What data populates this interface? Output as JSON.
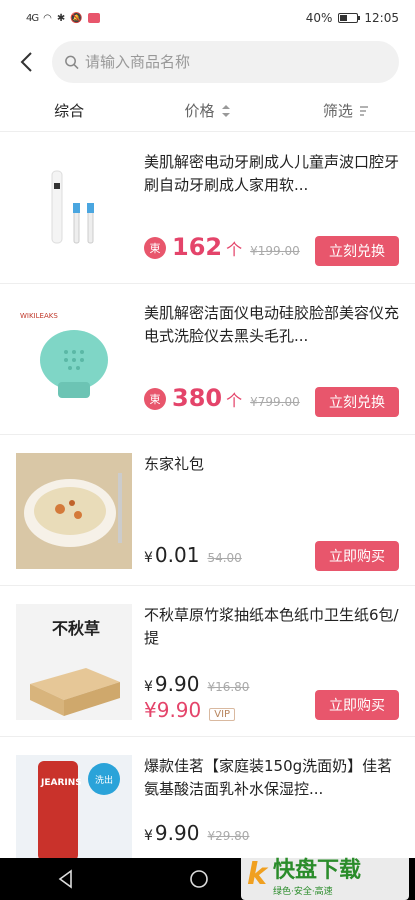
{
  "status": {
    "battery": "40%",
    "time": "12:05",
    "signal": "4G",
    "battery_level": 0.4
  },
  "search": {
    "placeholder": "请输入商品名称"
  },
  "sort": {
    "tabs": [
      "综合",
      "价格",
      "筛选"
    ]
  },
  "items": [
    {
      "title": "美肌解密电动牙刷成人儿童声波口腔牙刷自动牙刷成人家用软...",
      "coin": "東",
      "price": "162",
      "unit": "个",
      "old": "¥199.00",
      "button": "立刻兑换"
    },
    {
      "title": "美肌解密洁面仪电动硅胶脸部美容仪充电式洗脸仪去黑头毛孔...",
      "coin": "東",
      "price": "380",
      "unit": "个",
      "old": "¥799.00",
      "button": "立刻兑换",
      "brand": "WIKILEAKS"
    },
    {
      "title": "东家礼包",
      "currency": "¥",
      "price": "0.01",
      "old": "54.00",
      "button": "立即购买"
    },
    {
      "title": "不秋草原竹浆抽纸本色纸巾卫生纸6包/提",
      "currency": "¥",
      "price": "9.90",
      "old": "¥16.80",
      "vip_price": "¥9.90",
      "vip": "VIP",
      "button": "立即购买",
      "brand": "不秋草"
    },
    {
      "title": "爆款佳茗【家庭装150g洗面奶】佳茗氨基酸洁面乳补水保湿控...",
      "currency": "¥",
      "price": "9.90",
      "old": "¥29.80",
      "brand": "JEARINS",
      "tag": "洗出"
    }
  ],
  "watermark": {
    "logo": "k",
    "name": "快盘下载",
    "slogan": "绿色·安全·高速"
  }
}
